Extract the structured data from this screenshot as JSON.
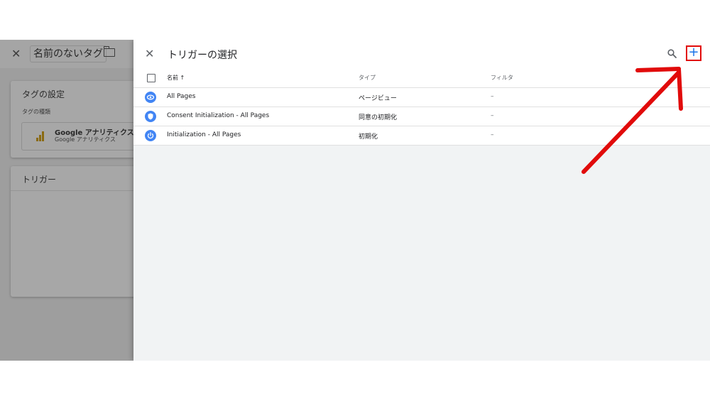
{
  "background_editor": {
    "tag_name": "名前のないタグ",
    "card_tag_settings": {
      "title": "タグの設定",
      "tag_type_label": "タグの種類",
      "tag_type_name": "Google アナリティクス: G",
      "tag_type_sub": "Google アナリティクス"
    },
    "card_trigger": {
      "title": "トリガー",
      "truncated_glyph": "ト"
    }
  },
  "panel": {
    "title": "トリガーの選択",
    "close_glyph": "✕",
    "add_glyph": "+",
    "columns": {
      "name": "名前",
      "sort_glyph": "↑",
      "type": "タイプ",
      "filter": "フィルタ"
    },
    "rows": [
      {
        "name": "All Pages",
        "type": "ページビュー",
        "filter": "–",
        "icon": "eye-icon"
      },
      {
        "name": "Consent Initialization - All Pages",
        "type": "同意の初期化",
        "filter": "–",
        "icon": "shield-icon"
      },
      {
        "name": "Initialization - All Pages",
        "type": "初期化",
        "filter": "–",
        "icon": "power-icon"
      }
    ]
  },
  "colors": {
    "accent_blue": "#1a73e8",
    "icon_blue": "#4285f4",
    "highlight_red": "#e10b0b",
    "overlay_gray": "#9e9e9e"
  }
}
